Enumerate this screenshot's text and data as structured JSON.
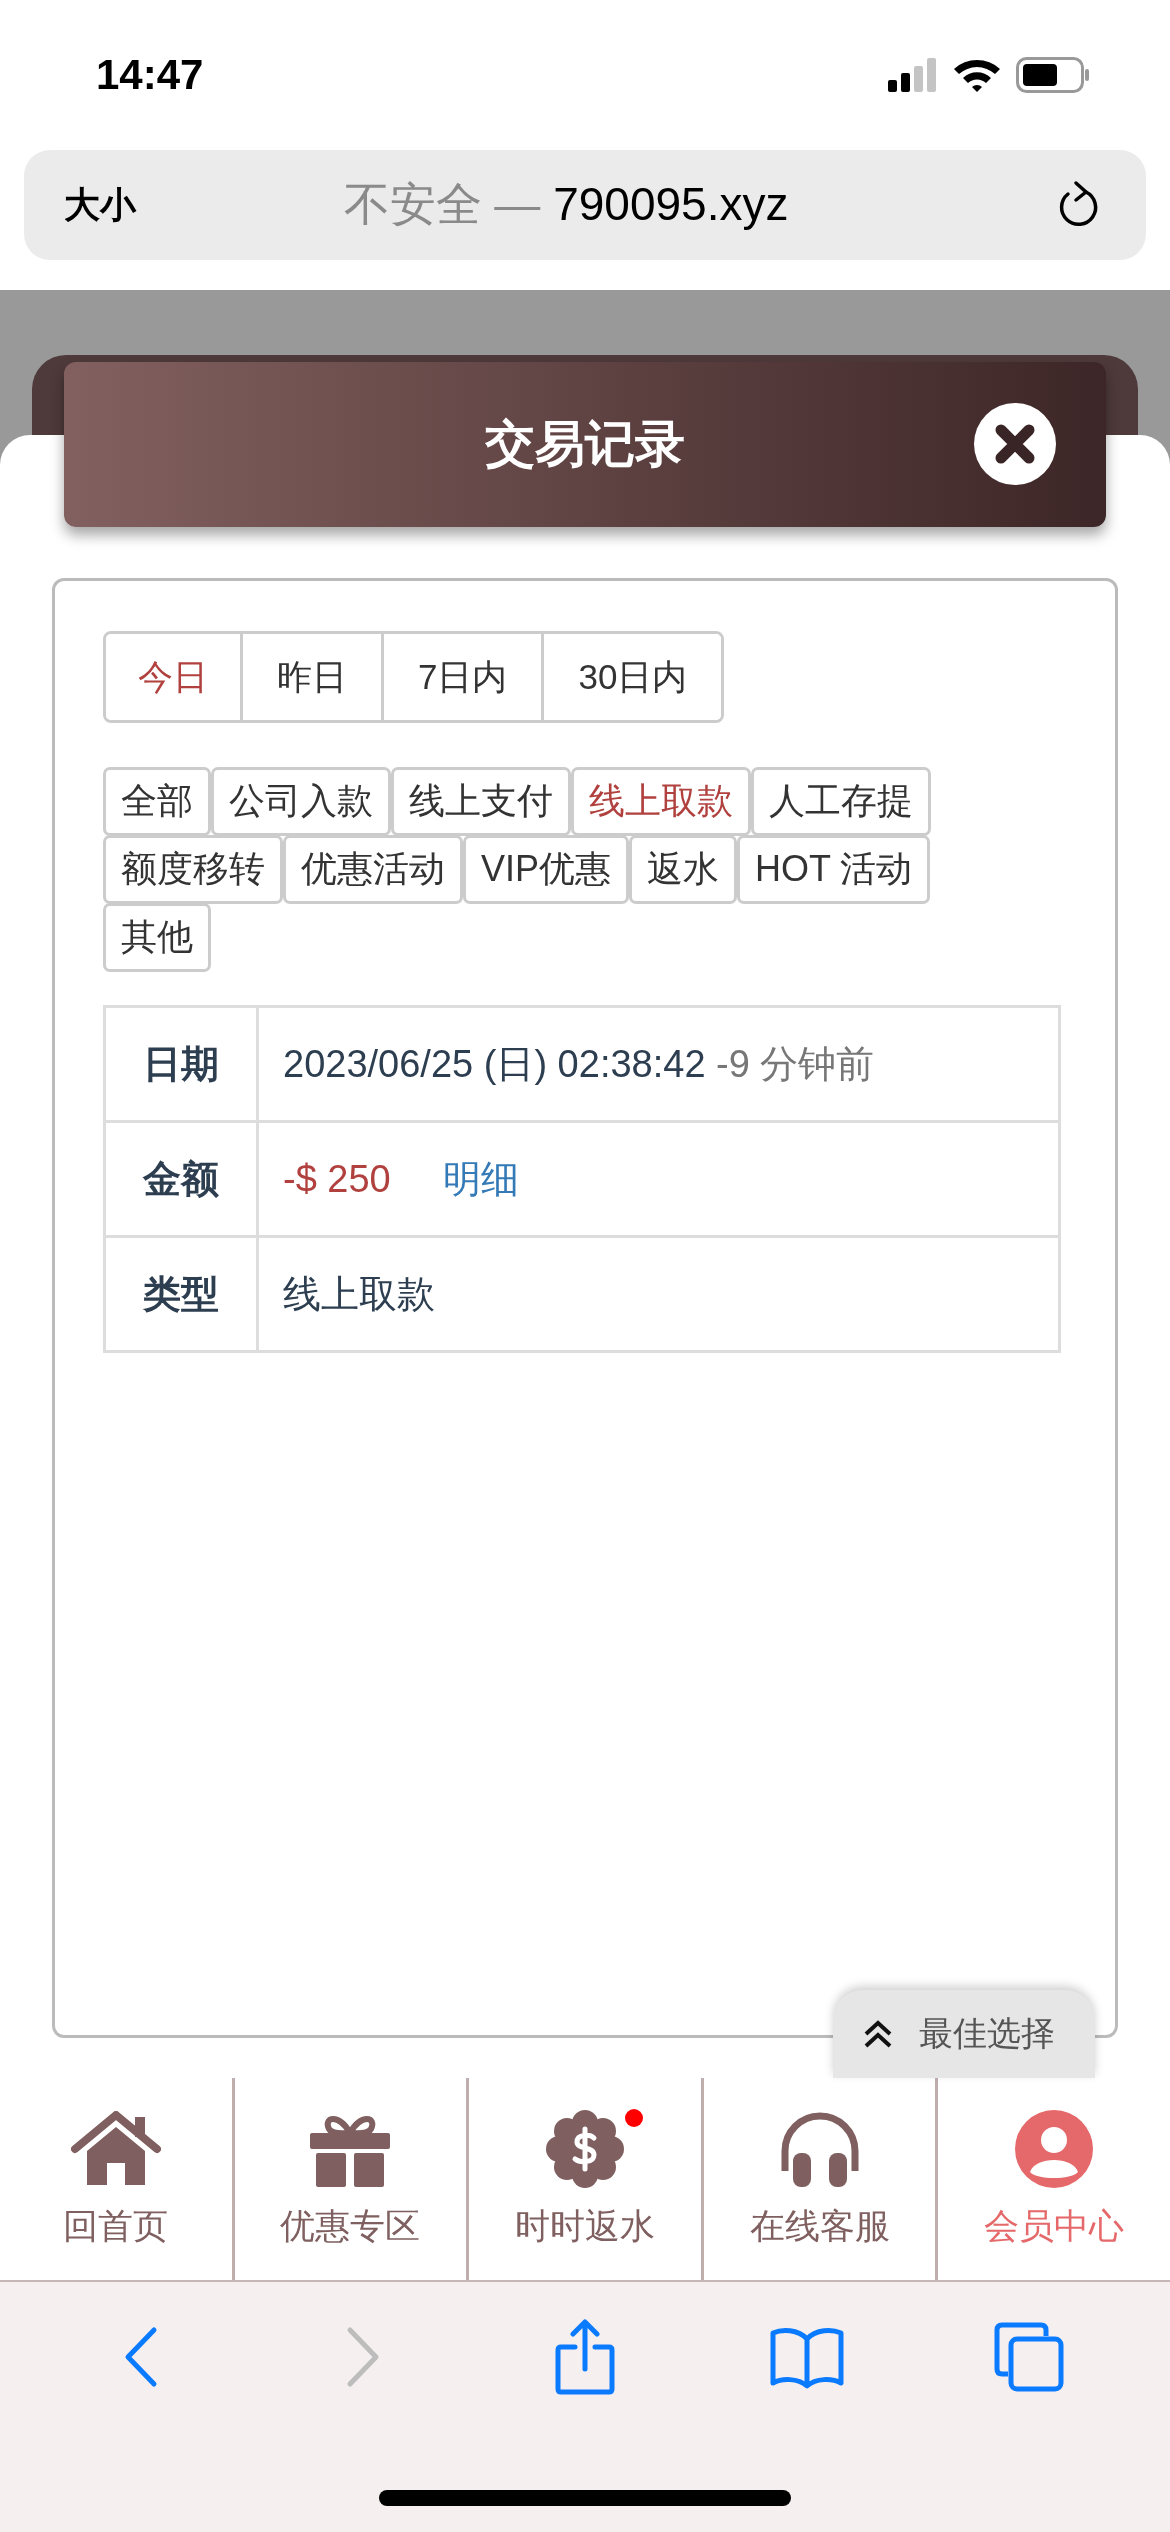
{
  "status_bar": {
    "time": "14:47"
  },
  "browser": {
    "text_size_label": "大小",
    "security": "不安全 —",
    "domain": "790095.xyz"
  },
  "modal": {
    "title": "交易记录"
  },
  "date_tabs": [
    {
      "label": "今日",
      "selected": true
    },
    {
      "label": "昨日",
      "selected": false
    },
    {
      "label": "7日内",
      "selected": false
    },
    {
      "label": "30日内",
      "selected": false
    }
  ],
  "type_filters": [
    {
      "label": "全部",
      "selected": false
    },
    {
      "label": "公司入款",
      "selected": false
    },
    {
      "label": "线上支付",
      "selected": false
    },
    {
      "label": "线上取款",
      "selected": true
    },
    {
      "label": "人工存提",
      "selected": false
    },
    {
      "label": "额度移转",
      "selected": false
    },
    {
      "label": "优惠活动",
      "selected": false
    },
    {
      "label": "VIP优惠",
      "selected": false
    },
    {
      "label": "返水",
      "selected": false
    },
    {
      "label": "HOT 活动",
      "selected": false
    },
    {
      "label": "其他",
      "selected": false
    }
  ],
  "record": [
    {
      "label": "日期",
      "kind": "date",
      "value": "2023/06/25 (日) 02:38:42",
      "note": "-9 分钟前"
    },
    {
      "label": "金额",
      "kind": "amount",
      "value": "-$ 250",
      "link": "明细"
    },
    {
      "label": "类型",
      "kind": "text",
      "value": "线上取款"
    }
  ],
  "float_button": {
    "label": "最佳选择"
  },
  "nav": [
    {
      "label": "回首页",
      "kind": "home",
      "selected": false,
      "badge": false
    },
    {
      "label": "优惠专区",
      "kind": "gift",
      "selected": false,
      "badge": false
    },
    {
      "label": "时时返水",
      "kind": "coin",
      "selected": false,
      "badge": true
    },
    {
      "label": "在线客服",
      "kind": "headset",
      "selected": false,
      "badge": false
    },
    {
      "label": "会员中心",
      "kind": "user",
      "selected": true,
      "badge": false
    }
  ],
  "browser_toolbar": [
    {
      "kind": "back",
      "disabled": false
    },
    {
      "kind": "forward",
      "disabled": true
    },
    {
      "kind": "share",
      "disabled": false
    },
    {
      "kind": "bookmarks",
      "disabled": false
    },
    {
      "kind": "tabs",
      "disabled": false
    }
  ]
}
